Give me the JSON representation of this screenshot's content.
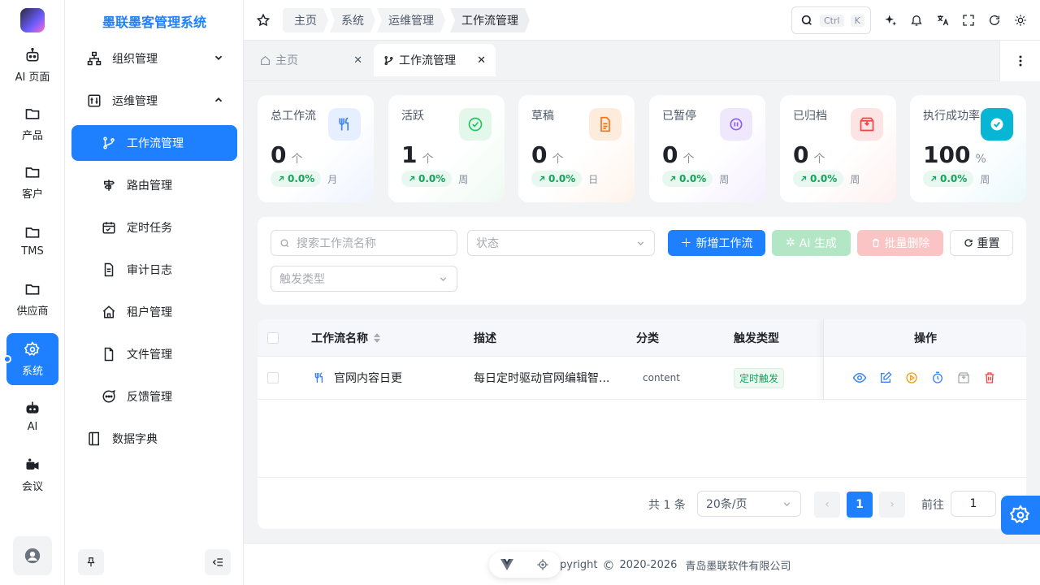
{
  "rail": {
    "items": [
      {
        "label": "AI 页面",
        "icon": "robot-icon"
      },
      {
        "label": "产品",
        "icon": "folder-icon"
      },
      {
        "label": "客户",
        "icon": "folder-icon"
      },
      {
        "label": "TMS",
        "icon": "folder-icon"
      },
      {
        "label": "供应商",
        "icon": "folder-icon"
      },
      {
        "label": "系统",
        "icon": "gear-icon",
        "active": true
      },
      {
        "label": "AI",
        "icon": "robot-icon"
      },
      {
        "label": "会议",
        "icon": "video-icon"
      }
    ]
  },
  "sidebar": {
    "brand": "墨联墨客管理系统",
    "items": [
      {
        "label": "组织管理",
        "icon": "org-icon",
        "expanded": false
      },
      {
        "label": "运维管理",
        "icon": "ops-icon",
        "expanded": true
      },
      {
        "label": "工作流管理",
        "icon": "branch-icon",
        "active": true
      },
      {
        "label": "路由管理",
        "icon": "signpost-icon"
      },
      {
        "label": "定时任务",
        "icon": "calendar-icon"
      },
      {
        "label": "审计日志",
        "icon": "document-icon"
      },
      {
        "label": "租户管理",
        "icon": "home-icon"
      },
      {
        "label": "文件管理",
        "icon": "file-icon"
      },
      {
        "label": "反馈管理",
        "icon": "chat-icon"
      },
      {
        "label": "数据字典",
        "icon": "book-icon"
      }
    ]
  },
  "header": {
    "breadcrumbs": [
      "主页",
      "系统",
      "运维管理",
      "工作流管理"
    ],
    "search_key1": "Ctrl",
    "search_key2": "K"
  },
  "tabs": [
    {
      "label": "主页",
      "active": false
    },
    {
      "label": "工作流管理",
      "active": true
    }
  ],
  "stats": [
    {
      "title": "总工作流",
      "value": "0",
      "unit": "个",
      "change": "0.0%",
      "period": "月",
      "icon": "fork-knife-icon",
      "color": "#3b82f6",
      "bg": "#e6efff"
    },
    {
      "title": "活跃",
      "value": "1",
      "unit": "个",
      "change": "0.0%",
      "period": "周",
      "icon": "check-circle-icon",
      "color": "#22c55e",
      "bg": "#e3f7ea"
    },
    {
      "title": "草稿",
      "value": "0",
      "unit": "个",
      "change": "0.0%",
      "period": "日",
      "icon": "draft-icon",
      "color": "#f97316",
      "bg": "#fdebdc"
    },
    {
      "title": "已暂停",
      "value": "0",
      "unit": "个",
      "change": "0.0%",
      "period": "周",
      "icon": "pause-icon",
      "color": "#8b5cf6",
      "bg": "#efe8fd"
    },
    {
      "title": "已归档",
      "value": "0",
      "unit": "个",
      "change": "0.0%",
      "period": "周",
      "icon": "archive-icon",
      "color": "#ef4444",
      "bg": "#fde4e4"
    },
    {
      "title": "执行成功率",
      "value": "100",
      "unit": "%",
      "change": "0.0%",
      "period": "周",
      "icon": "check-badge-icon",
      "color": "#ffffff",
      "bg": "#06b6d4"
    }
  ],
  "filter": {
    "search_placeholder": "搜索工作流名称",
    "status_placeholder": "状态",
    "trigger_placeholder": "触发类型",
    "add_label": "新增工作流",
    "ai_label": "AI 生成",
    "batch_delete_label": "批量删除",
    "reset_label": "重置"
  },
  "table": {
    "columns": [
      "工作流名称",
      "描述",
      "分类",
      "触发类型",
      "操作"
    ],
    "rows": [
      {
        "name": "官网内容日更",
        "description": "每日定时驱动官网编辑智...",
        "category": "content",
        "trigger": "定时触发"
      }
    ]
  },
  "pager": {
    "total": "共 1 条",
    "page_size": "20条/页",
    "current_page": "1",
    "goto_label": "前往",
    "goto_value": "1"
  },
  "footer": {
    "copyright": "Copyright",
    "years": "2020-2026",
    "company": "青岛墨联软件有限公司"
  }
}
